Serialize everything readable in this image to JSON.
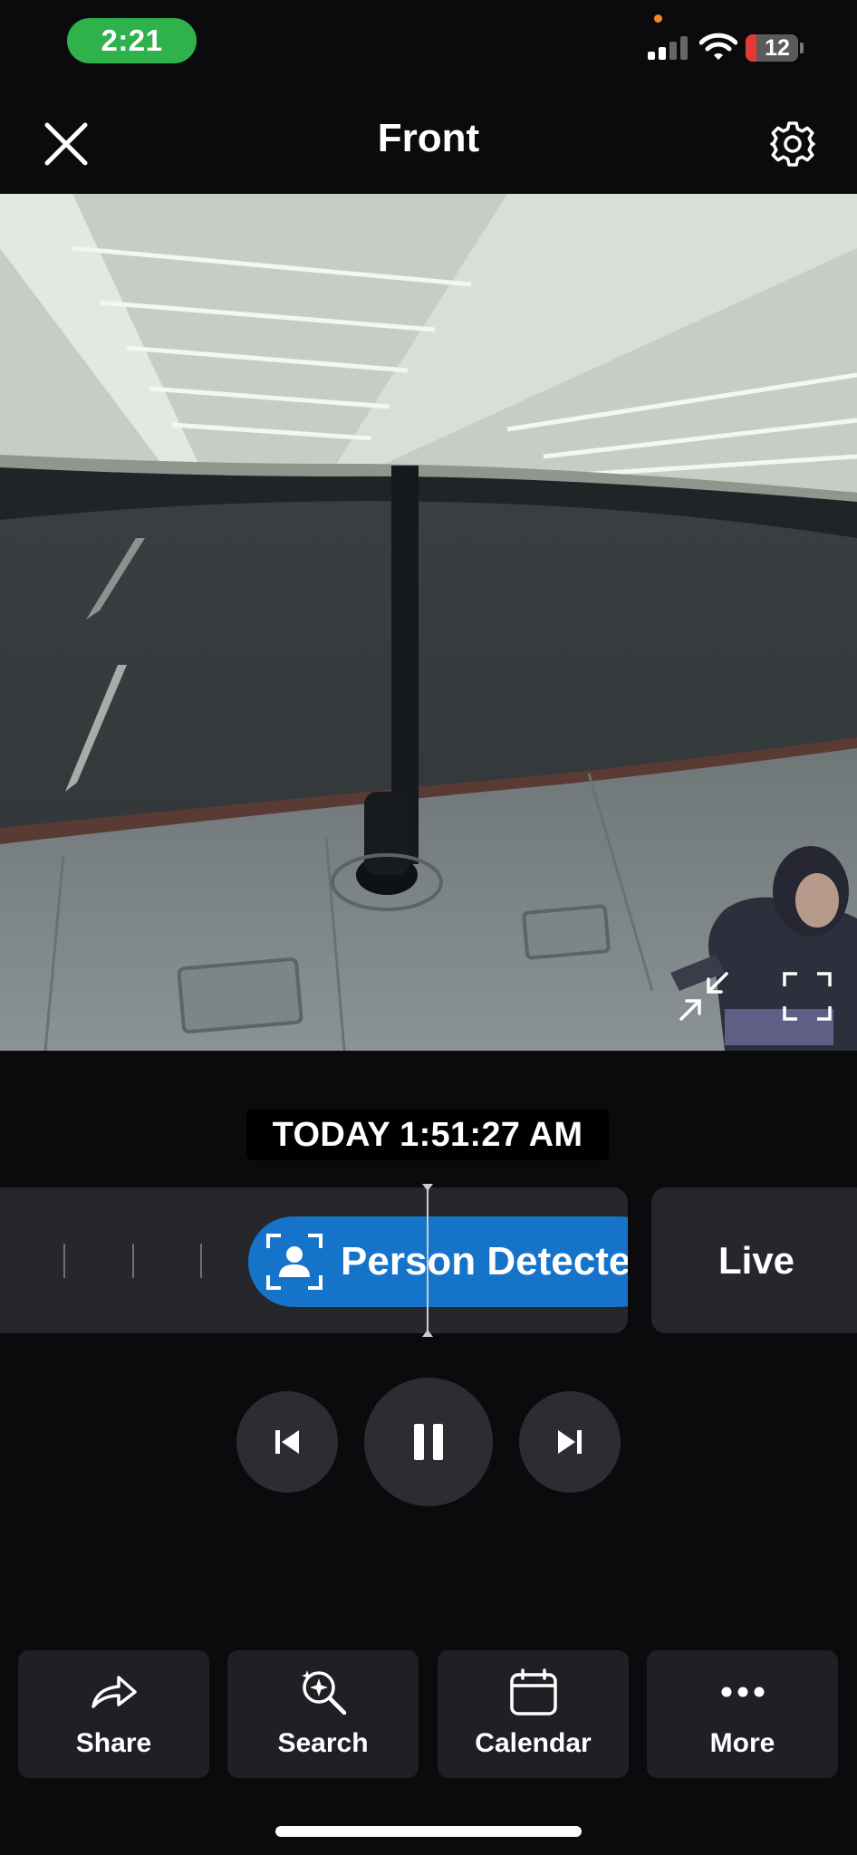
{
  "status_bar": {
    "time": "2:21",
    "battery_level": "12"
  },
  "header": {
    "title": "Front"
  },
  "player": {
    "timestamp": "TODAY 1:51:27 AM",
    "event_label": "Person Detecte",
    "live_label": "Live"
  },
  "actions": [
    {
      "label": "Share",
      "icon": "share-icon"
    },
    {
      "label": "Search",
      "icon": "search-sparkle-icon"
    },
    {
      "label": "Calendar",
      "icon": "calendar-icon"
    },
    {
      "label": "More",
      "icon": "more-dots-icon"
    }
  ],
  "colors": {
    "background": "#0b0b0d",
    "time_pill": "#2fb24c",
    "event_pill": "#1574c9",
    "panel": "#25272c",
    "button": "#2b2d32"
  }
}
